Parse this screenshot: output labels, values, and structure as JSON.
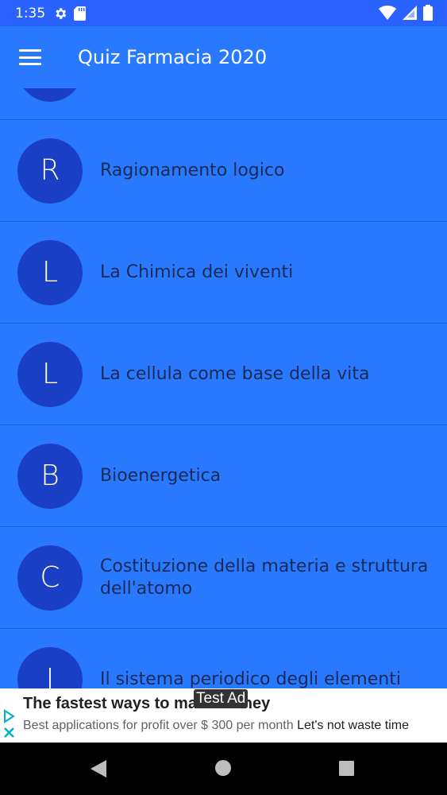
{
  "status_bar": {
    "time": "1:35",
    "icons": [
      "settings-icon",
      "sd-card-icon",
      "wifi-icon",
      "signal-icon",
      "battery-icon"
    ]
  },
  "app_bar": {
    "title": "Quiz Farmacia 2020",
    "menu_icon": "hamburger-menu-icon"
  },
  "list": {
    "items": [
      {
        "initial": "",
        "label": ""
      },
      {
        "initial": "R",
        "label": "Ragionamento logico"
      },
      {
        "initial": "L",
        "label": "La Chimica dei viventi"
      },
      {
        "initial": "L",
        "label": "La cellula come base della vita"
      },
      {
        "initial": "B",
        "label": "Bioenergetica"
      },
      {
        "initial": "C",
        "label": "Costituzione della materia e struttura dell'atomo"
      },
      {
        "initial": "I",
        "label": "Il sistema periodico degli elementi"
      }
    ]
  },
  "ad": {
    "tag": "Test Ad",
    "headline": "The fastest ways to make money",
    "body": "Best applications for profit over $ 300 per month",
    "cta": "Let's not waste time"
  },
  "colors": {
    "primary": "#2979ff",
    "status_bar": "#2962ff",
    "avatar": "#1a3fc4",
    "text": "#1b2a56"
  }
}
